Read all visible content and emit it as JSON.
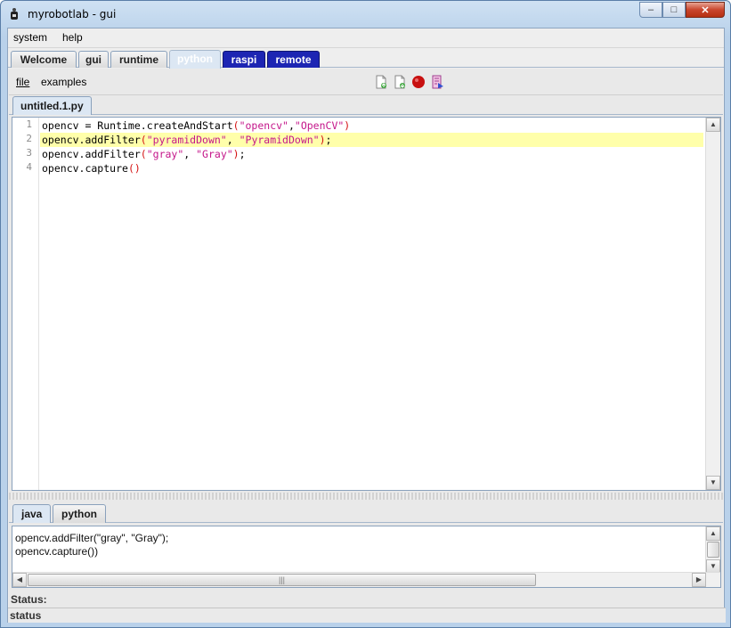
{
  "window": {
    "title": "myrobotlab - gui",
    "icon": "robot-app-icon",
    "controls": {
      "minimize": "–",
      "maximize": "□",
      "close": "✕"
    }
  },
  "menubar": {
    "items": [
      "system",
      "help"
    ]
  },
  "tabs": [
    {
      "label": "Welcome",
      "selected": false
    },
    {
      "label": "gui",
      "selected": false
    },
    {
      "label": "runtime",
      "selected": false
    },
    {
      "label": "python",
      "selected": true
    },
    {
      "label": "raspi",
      "selected": false
    },
    {
      "label": "remote",
      "selected": false
    }
  ],
  "python_panel": {
    "menu": {
      "file": "file",
      "examples": "examples"
    },
    "toolbar": [
      "new-file-icon",
      "open-file-icon",
      "record-icon",
      "execute-script-icon"
    ],
    "editor_tab": "untitled.1.py",
    "code_lines": [
      "opencv = Runtime.createAndStart(\"opencv\",\"OpenCV\")",
      "opencv.addFilter(\"pyramidDown\", \"PyramidDown\");",
      "opencv.addFilter(\"gray\", \"Gray\");",
      "opencv.capture()"
    ],
    "line_numbers": [
      "1",
      "2",
      "3",
      "4"
    ],
    "highlighted_line": 2,
    "bottom_tabs": [
      {
        "label": "java",
        "selected": true
      },
      {
        "label": "python",
        "selected": false
      }
    ],
    "console_lines": [
      "opencv.addFilter(\"gray\", \"Gray\");",
      "opencv.capture())"
    ]
  },
  "status": {
    "label": "Status:",
    "bar": "status"
  },
  "colors": {
    "string": "#c4168a",
    "paren": "#d41111",
    "highlight": "#ffffaa",
    "dark_tab": "#1d25b3"
  }
}
